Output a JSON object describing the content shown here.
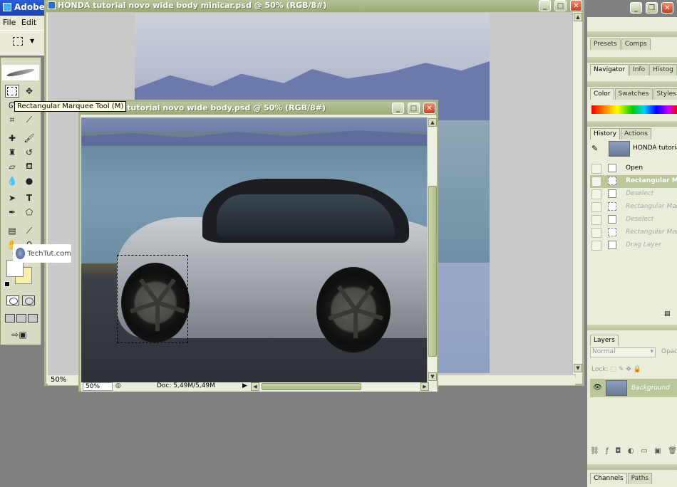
{
  "app": {
    "title": "Adobe"
  },
  "menu": {
    "items": [
      "File",
      "Edit"
    ]
  },
  "tooltip": {
    "text": "Rectangular Marquee Tool (M)"
  },
  "watermark": {
    "text": "TechTut.com"
  },
  "bg_document": {
    "title": "HONDA tutorial novo wide body minicar.psd @ 50% (RGB/8#)",
    "zoom": "50%"
  },
  "fg_document": {
    "title": "HONDA tutorial novo wide body.psd @ 50% (RGB/8#)",
    "zoom": "50%",
    "doc_info": "Doc: 5,49M/5,49M"
  },
  "panels": {
    "presets_tabs": [
      "Presets",
      "Comps"
    ],
    "navigator_tabs": [
      "Navigator",
      "Info",
      "Histog"
    ],
    "color_tabs": [
      "Color",
      "Swatches",
      "Styles"
    ],
    "history_tabs": [
      "History",
      "Actions"
    ],
    "history_snapshot": "HONDA tutorial",
    "history_items": [
      {
        "label": "Open",
        "state": "normal"
      },
      {
        "label": "Rectangular Ma",
        "state": "current"
      },
      {
        "label": "Deselect",
        "state": "dim"
      },
      {
        "label": "Rectangular Mar",
        "state": "dim"
      },
      {
        "label": "Deselect",
        "state": "dim"
      },
      {
        "label": "Rectangular Mar",
        "state": "dim"
      },
      {
        "label": "Drag Layer",
        "state": "dim"
      }
    ],
    "layers_tab": "Layers",
    "blend_mode": "Normal",
    "opacity_label": "Opac",
    "lock_label": "Lock:",
    "layer_name": "Background",
    "bottom_tabs": [
      "Channels",
      "Paths"
    ]
  },
  "colors": {
    "window_frame": "#a7b58b",
    "panel_bg": "#ebecd9",
    "workspace": "#808080",
    "close_btn": "#c8421f"
  }
}
